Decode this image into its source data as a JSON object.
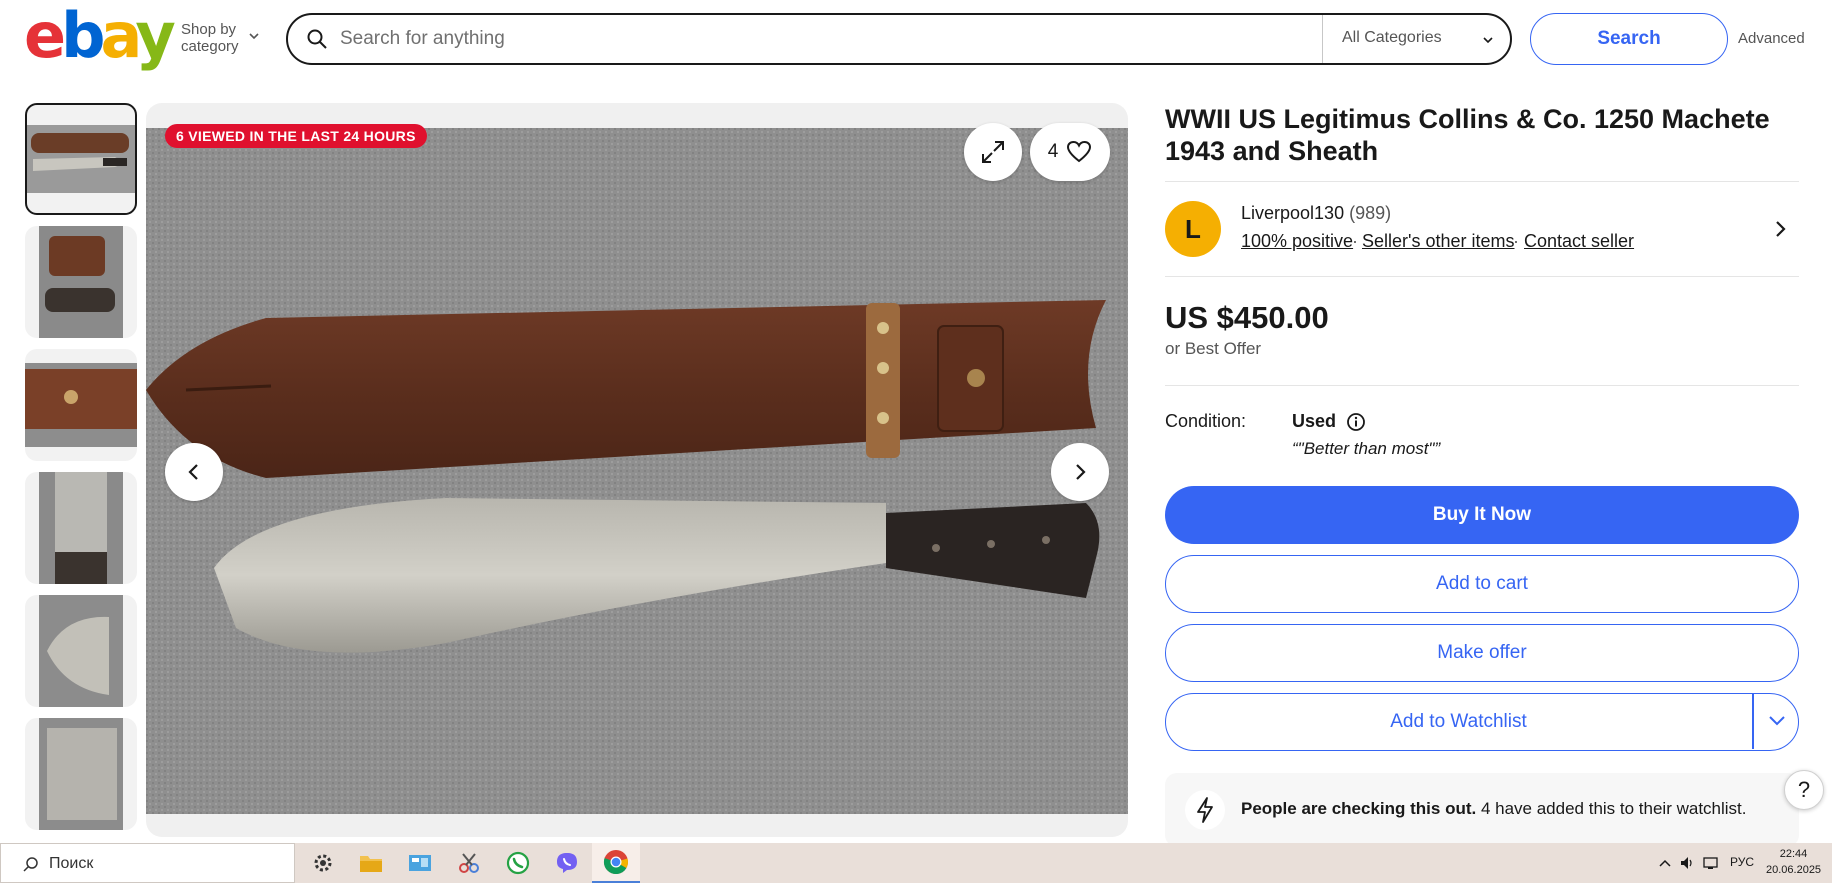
{
  "header": {
    "logo": [
      "e",
      "b",
      "a",
      "y"
    ],
    "shop_by_category": [
      "Shop by",
      "category"
    ],
    "search_placeholder": "Search for anything",
    "category_select": "All Categories",
    "search_button": "Search",
    "advanced_link": "Advanced"
  },
  "gallery": {
    "viewed_badge": "6 VIEWED IN THE LAST 24 HOURS",
    "watch_count": "4",
    "thumbnail_count": 6,
    "icons": [
      "expand-icon",
      "heart-icon",
      "chevron-left-icon",
      "chevron-right-icon"
    ]
  },
  "item": {
    "title": "WWII US Legitimus Collins & Co. 1250 Machete 1943 and Sheath",
    "seller": {
      "avatar_letter": "L",
      "name": "Liverpool130",
      "feedback_count": "(989)",
      "positive": "100% positive",
      "other_items": "Seller's other items",
      "contact": "Contact seller"
    },
    "price": "US $450.00",
    "best_offer": "or Best Offer",
    "condition_label": "Condition:",
    "condition_value": "Used",
    "condition_quote": "“\"Better than most\"”",
    "buy_now": "Buy It Now",
    "add_to_cart": "Add to cart",
    "make_offer": "Make offer",
    "add_to_watchlist": "Add to Watchlist",
    "checking_bold": "People are checking this out.",
    "checking_rest": " 4 have added this to their watchlist.",
    "help": "?"
  },
  "colors": {
    "accent": "#3665f3",
    "badge_red": "#e0102e",
    "avatar": "#f5af02"
  },
  "taskbar": {
    "search_label": "Поиск",
    "language": "РУС",
    "time": "22:44",
    "date": "20.06.2025"
  }
}
